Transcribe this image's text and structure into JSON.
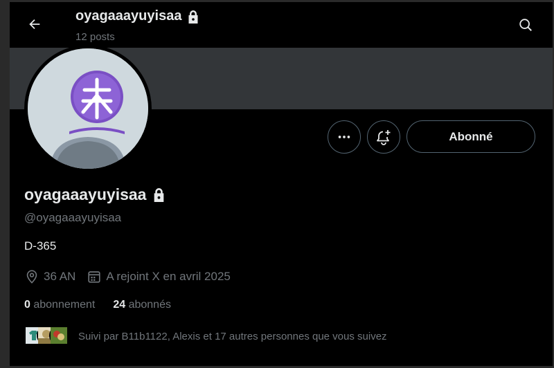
{
  "header": {
    "title": "oyagaaayuyisaa",
    "posts_count": "12 posts"
  },
  "profile": {
    "display_name": "oyagaaayuyisaa",
    "handle": "@oyagaaayuyisaa",
    "bio": "D-365",
    "location": "36 AN",
    "joined": "A rejoint X en avril 2025",
    "following_count": "0",
    "following_label": "abonnement",
    "followers_count": "24",
    "followers_label": "abonnés",
    "followed_by": "Suivi par B11b1122, Alexis et 17 autres personnes que vous suivez"
  },
  "actions": {
    "follow_label": "Abonné"
  },
  "icons": {
    "back": "arrow-left-icon",
    "search": "search-icon",
    "lock": "lock-icon",
    "more": "more-icon",
    "notify": "bell-plus-icon",
    "location": "location-pin-icon",
    "calendar": "calendar-icon"
  },
  "colors": {
    "background": "#000000",
    "banner": "#333639",
    "avatar_bg": "#cfd9de",
    "muted_text": "#71767b",
    "primary_text": "#e7e9ea",
    "border": "#536471"
  }
}
